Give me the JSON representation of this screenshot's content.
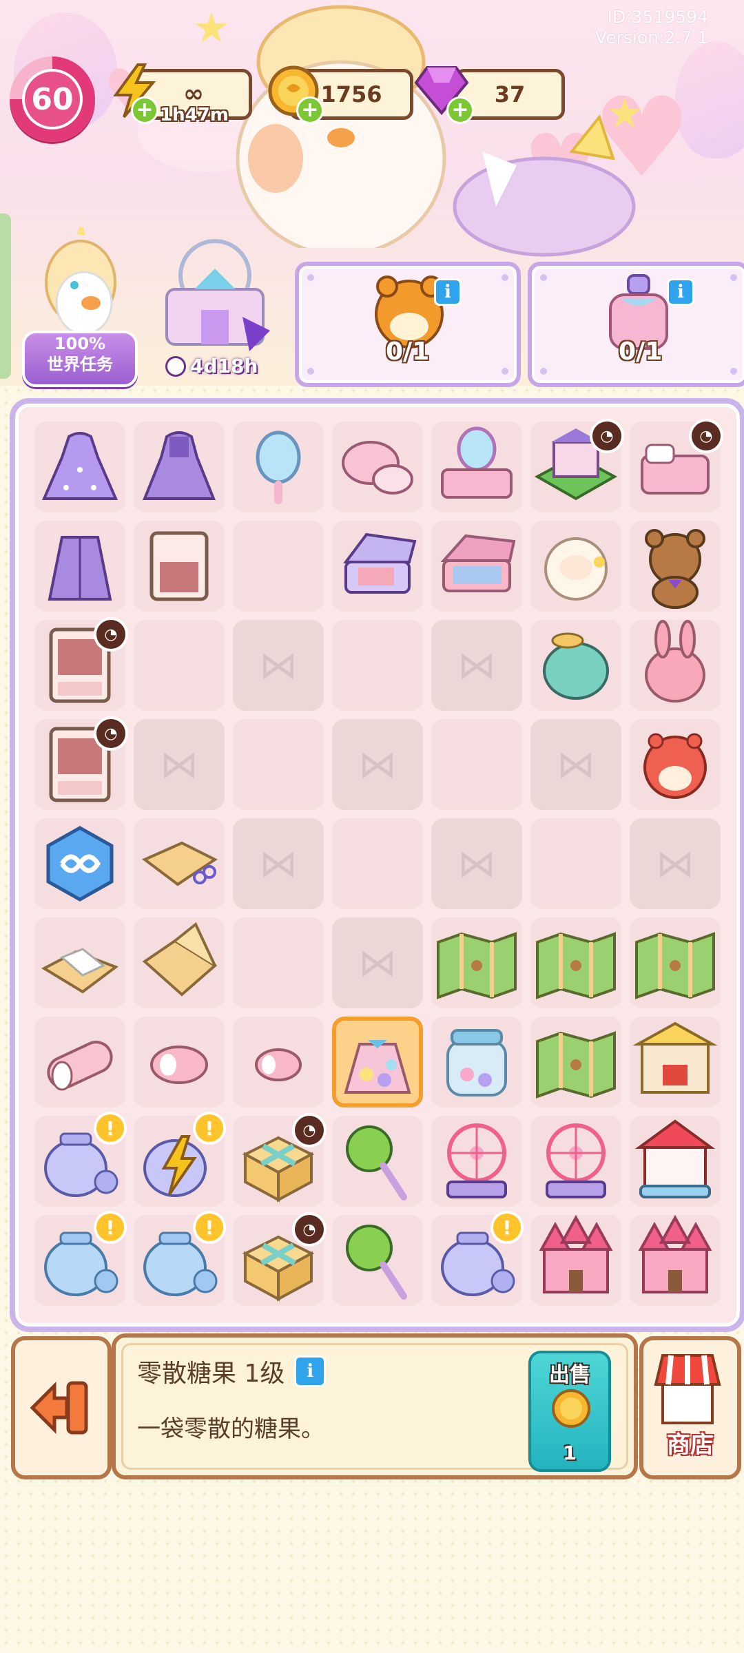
{
  "header": {
    "id_text": "ID:3519594",
    "version_text": "Version:2.7.1",
    "level": "60",
    "energy_value": "∞",
    "energy_timer": "1h47m",
    "coins": "1756",
    "gems": "37"
  },
  "world_task": {
    "percent": "100%",
    "label": "世界任务"
  },
  "event": {
    "timer": "4d18h"
  },
  "orders": [
    {
      "icon": "hamster-plush-icon",
      "progress": "0/1"
    },
    {
      "icon": "perfume-bottle-icon",
      "progress": "0/1"
    }
  ],
  "board": {
    "columns": 7,
    "rows": 9,
    "cells": [
      [
        "purple-ballgown",
        "purple-dress",
        "hand-mirror",
        "powder-compact",
        "vanity-table",
        "flower-shop",
        "bed-set"
      ],
      [
        "purple-jacket",
        "wardrobe-small",
        "empty",
        "eyeshadow-palette-purple",
        "eyeshadow-palette-pink",
        "sheep-plush",
        "bear-plush"
      ],
      [
        "wardrobe-large",
        "empty",
        "locked",
        "empty",
        "locked",
        "seal-plush",
        "bunny-plush"
      ],
      [
        "wardrobe-large",
        "locked",
        "empty",
        "locked",
        "empty",
        "locked",
        "hamster-plush"
      ],
      [
        "infinity-chest",
        "box-scissors",
        "locked",
        "empty",
        "locked",
        "empty",
        "locked"
      ],
      [
        "open-box",
        "open-box-2",
        "empty",
        "locked",
        "map",
        "map",
        "map"
      ],
      [
        "marshmallow-roll",
        "marshmallow-small",
        "marshmallow-tiny",
        "candy-bag",
        "candy-jar",
        "map",
        "gift-stall"
      ],
      [
        "glass-jar",
        "glass-jar-energy",
        "gift-box",
        "lollipop",
        "ferris-wheel",
        "ferris-wheel",
        "carousel"
      ],
      [
        "glass-jar-blue",
        "glass-jar-blue",
        "gift-box",
        "lollipop",
        "glass-jar",
        "castle",
        "castle"
      ]
    ],
    "selected": "6-3"
  },
  "info_panel": {
    "title": "零散糖果 1级",
    "description": "一袋零散的糖果。",
    "sell_label": "出售",
    "sell_price": "1"
  },
  "shop_label": "商店",
  "colors": {
    "accent": "#cbb3ec",
    "level": "#e23a78",
    "coin": "#f7b731",
    "gem": "#c44fd6",
    "energy": "#f6c21c",
    "sell": "#23b3bf"
  }
}
